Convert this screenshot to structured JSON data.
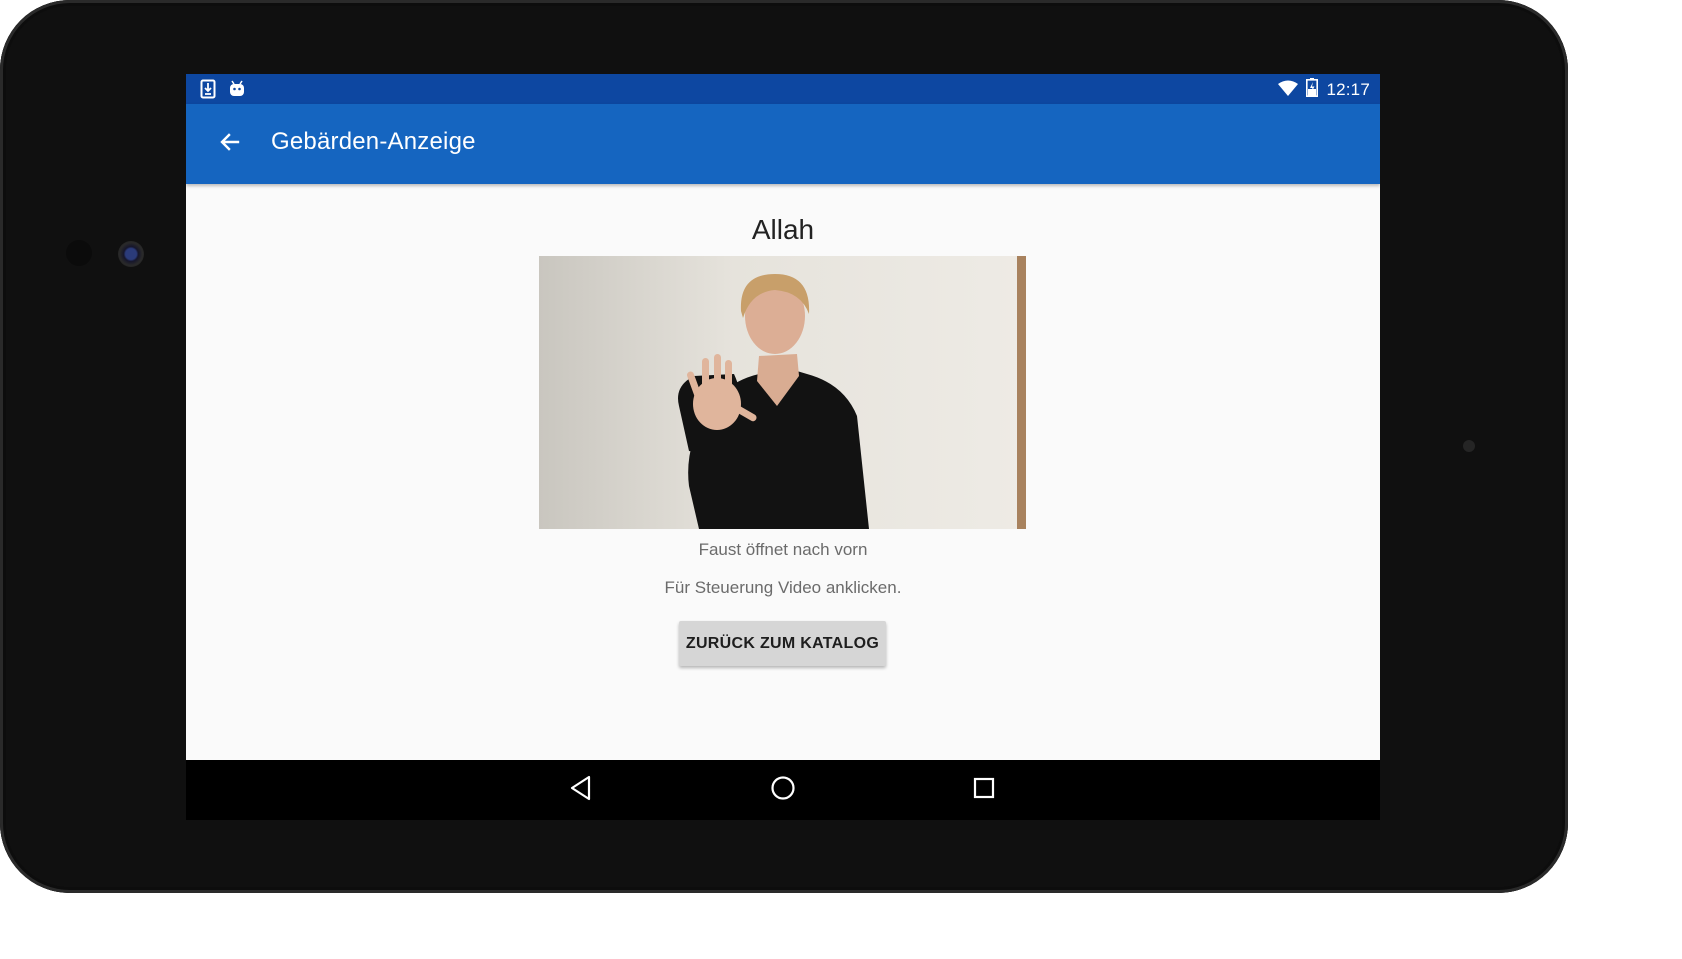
{
  "status_bar": {
    "time": "12:17",
    "left_icons": [
      "download-icon",
      "android-icon"
    ],
    "right_icons": [
      "wifi-icon",
      "battery-charging-icon"
    ]
  },
  "app_bar": {
    "title": "Gebärden-Anzeige",
    "back_icon": "arrow-back-icon",
    "color": "#1565c0",
    "status_color": "#0d47a1"
  },
  "main": {
    "sign_title": "Allah",
    "description": "Faust öffnet nach vorn",
    "hint": "Für Steuerung Video anklicken.",
    "back_button_label": "ZURÜCK ZUM KATALOG"
  },
  "nav_bar": {
    "icons": [
      "back-triangle-icon",
      "home-circle-icon",
      "recents-square-icon"
    ]
  }
}
